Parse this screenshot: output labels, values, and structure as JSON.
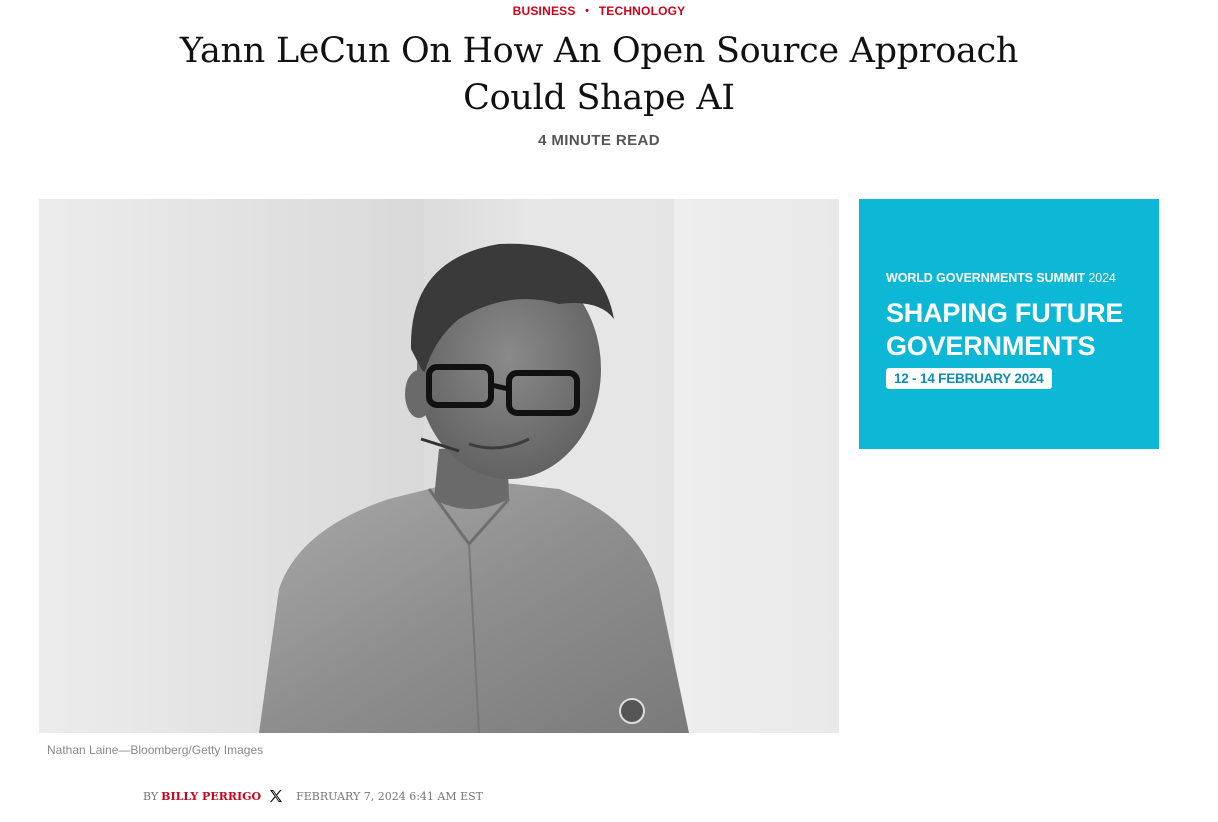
{
  "article": {
    "topics": [
      "BUSINESS",
      "TECHNOLOGY"
    ],
    "headline": "Yann LeCun On How An Open Source Approach Could Shape AI",
    "read_time": "4 MINUTE READ",
    "image_caption": "Nathan Laine—Bloomberg/Getty Images",
    "byline": {
      "prefix": "BY",
      "author": "BILLY PERRIGO",
      "social_icon": "x-logo-icon",
      "date": "FEBRUARY 7, 2024 6:41 AM EST"
    }
  },
  "ad": {
    "summit": "WORLD GOVERNMENTS SUMMIT",
    "summit_year": "2024",
    "headline_line1": "SHAPING FUTURE",
    "headline_line2": "GOVERNMENTS",
    "dates": "12 - 14 FEBRUARY 2024",
    "background_color": "#0db7d6"
  },
  "colors": {
    "accent": "#d0021b",
    "text": "#111111",
    "muted": "#777777"
  }
}
